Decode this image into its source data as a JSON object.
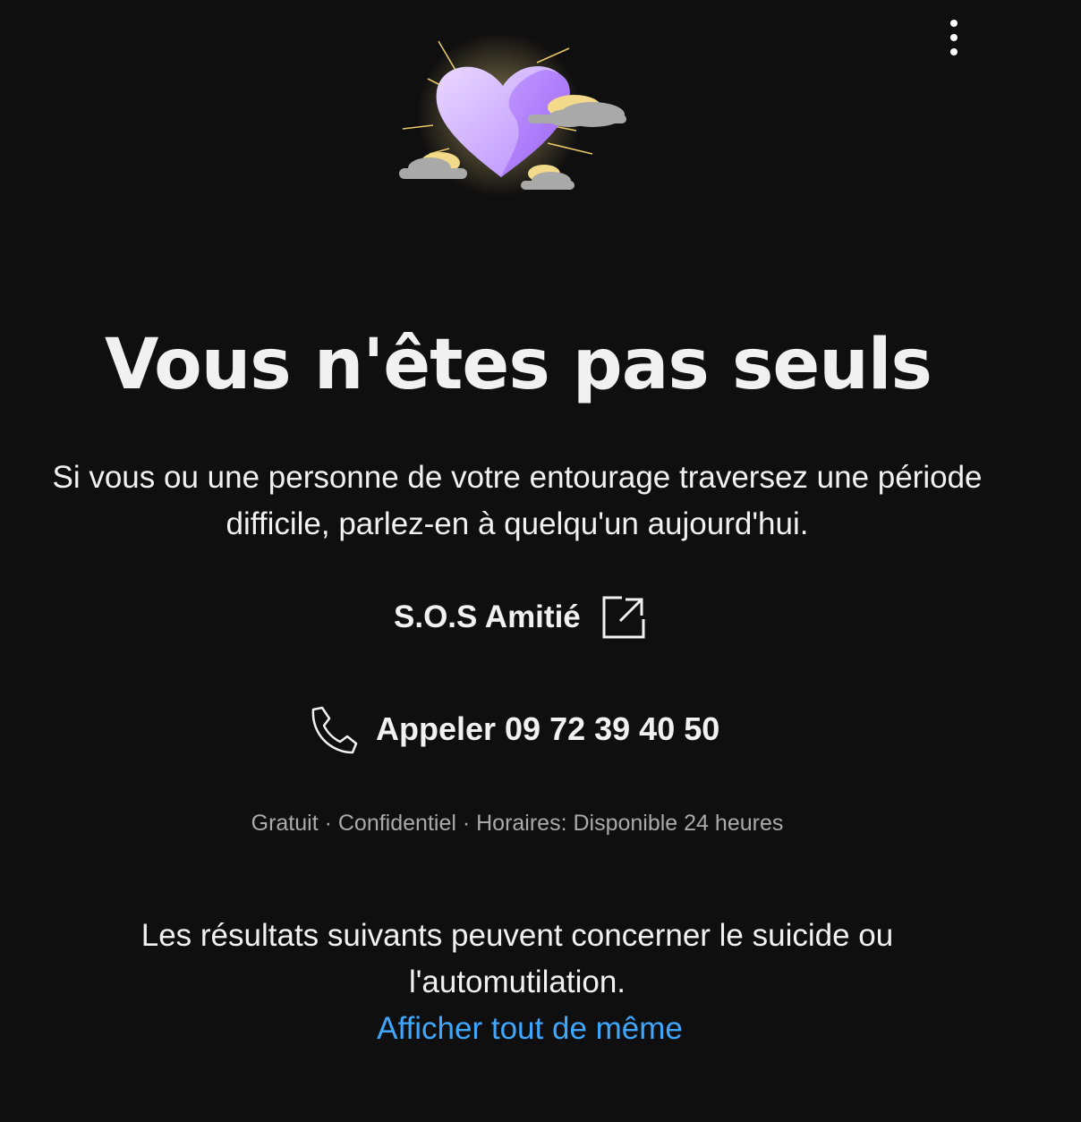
{
  "menu": {
    "icon": "more-vert-icon"
  },
  "illustration": {
    "icon": "heart-with-clouds-illustration"
  },
  "title": "Vous n'êtes pas seuls",
  "intro": "Si vous ou une personne de votre entourage traversez une période difficile, parlez-en à quelqu'un aujourd'hui.",
  "helpline": {
    "name": "S.O.S Amitié",
    "link_icon": "external-link-icon",
    "call_label": "Appeler 09 72 39 40 50",
    "call_icon": "phone-icon",
    "meta": "Gratuit · Confidentiel · Horaires: Disponible 24 heures"
  },
  "warning": "Les résultats suivants peuvent concerner le suicide ou l'automutilation.",
  "show_anyway_label": "Afficher tout de même",
  "colors": {
    "background": "#0f0f0f",
    "text": "#f1f1f1",
    "muted_text": "#aaaaaa",
    "link": "#3ea6ff",
    "heart": "#b98cff",
    "cloud": "#a9a9a9",
    "glow": "#f3d98a"
  }
}
